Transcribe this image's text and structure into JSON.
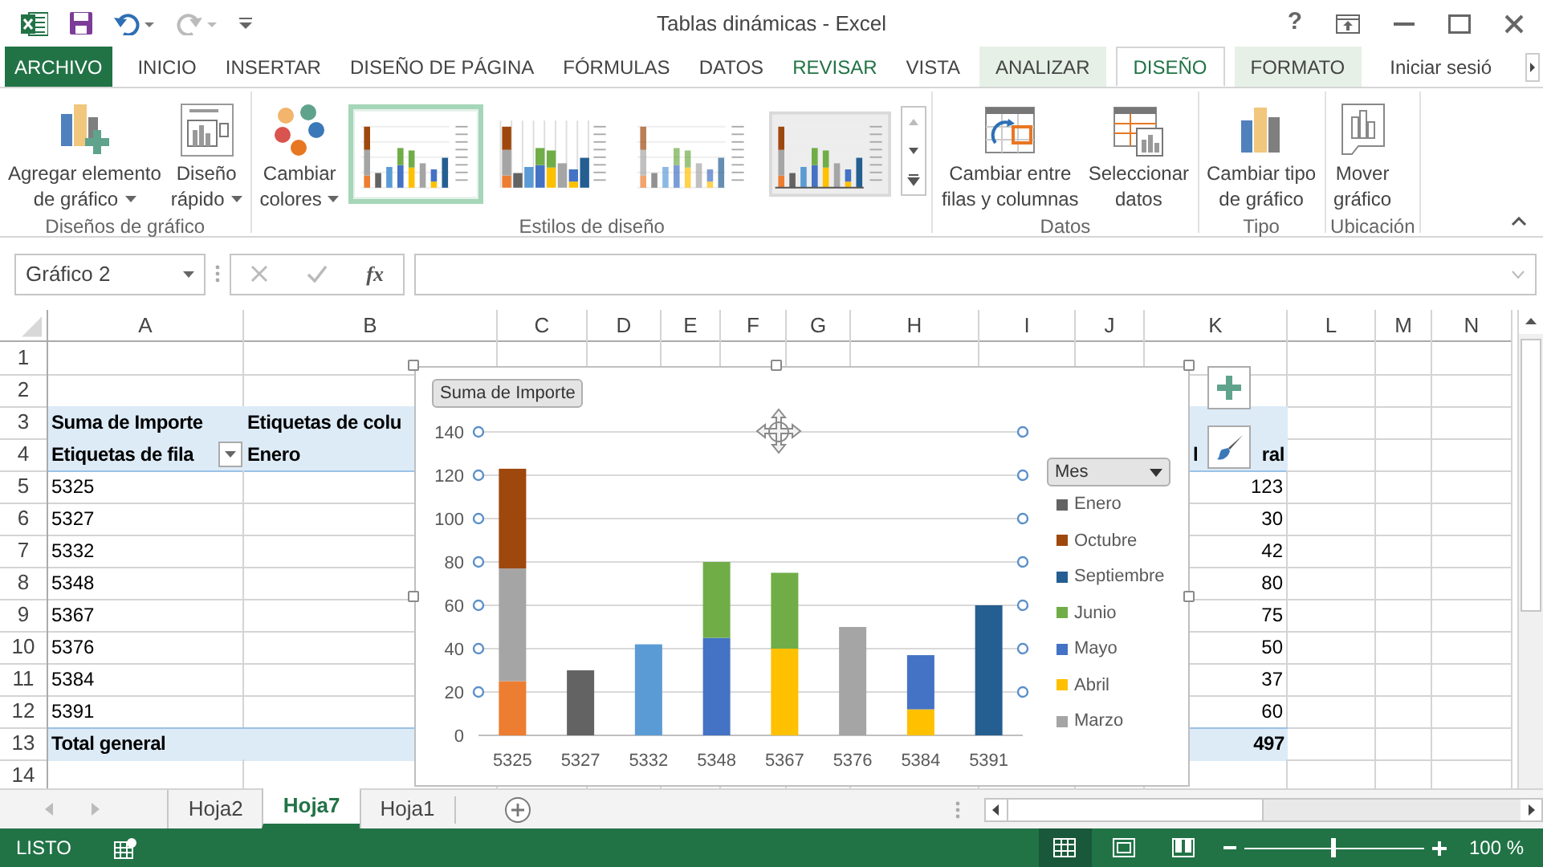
{
  "window": {
    "title": "Tablas dinámicas - Excel",
    "help": "?"
  },
  "ribbon_tabs": [
    {
      "label": "ARCHIVO",
      "kind": "file",
      "selected": false
    },
    {
      "label": "INICIO",
      "kind": "tab",
      "selected": false
    },
    {
      "label": "INSERTAR",
      "kind": "tab",
      "selected": false
    },
    {
      "label": "DISEÑO DE PÁGINA",
      "kind": "tab",
      "selected": false
    },
    {
      "label": "FÓRMULAS",
      "kind": "tab",
      "selected": false
    },
    {
      "label": "DATOS",
      "kind": "tab",
      "selected": false
    },
    {
      "label": "REVISAR",
      "kind": "highlighted",
      "selected": false
    },
    {
      "label": "VISTA",
      "kind": "tab",
      "selected": false
    },
    {
      "label": "ANALIZAR",
      "kind": "contextual",
      "selected": false
    },
    {
      "label": "DISEÑO",
      "kind": "contextual",
      "selected": true
    },
    {
      "label": "FORMATO",
      "kind": "contextual",
      "selected": false
    }
  ],
  "sign_in": "Iniciar sesió",
  "ribbon_groups": [
    {
      "label": "Diseños de gráfico",
      "items": [
        {
          "kind": "button",
          "lines": [
            "Agregar elemento",
            "de gráfico"
          ],
          "dropdown": true
        },
        {
          "kind": "button",
          "lines": [
            "Diseño",
            "rápido"
          ],
          "dropdown": true
        }
      ]
    },
    {
      "label": "Estilos de diseño",
      "items": [
        {
          "kind": "button",
          "lines": [
            "Cambiar",
            "colores"
          ],
          "dropdown": true
        },
        {
          "kind": "gallery",
          "thumbnails": [
            {
              "selected": true
            },
            {
              "selected": false
            },
            {
              "selected": false
            },
            {
              "selected": false
            }
          ]
        }
      ]
    },
    {
      "label": "Datos",
      "items": [
        {
          "kind": "button",
          "lines": [
            "Cambiar entre",
            "filas y columnas"
          ],
          "dropdown": false
        },
        {
          "kind": "button",
          "lines": [
            "Seleccionar",
            "datos"
          ],
          "dropdown": false
        }
      ]
    },
    {
      "label": "Tipo",
      "items": [
        {
          "kind": "button",
          "lines": [
            "Cambiar tipo",
            "de gráfico"
          ],
          "dropdown": false
        }
      ]
    },
    {
      "label": "Ubicación",
      "items": [
        {
          "kind": "button",
          "lines": [
            "Mover",
            "gráfico"
          ],
          "dropdown": false
        }
      ]
    }
  ],
  "formula_bar": {
    "name_box": "Gráfico 2",
    "function_label": "fx"
  },
  "sheet": {
    "columns": [
      "A",
      "B",
      "C",
      "D",
      "E",
      "F",
      "G",
      "H",
      "I",
      "J",
      "K",
      "L",
      "M",
      "N"
    ],
    "rows": [
      {
        "number": "1",
        "kind": "data"
      },
      {
        "number": "2",
        "kind": "data"
      },
      {
        "number": "3",
        "kind": "header",
        "cells": {
          "a": "Suma de Importe",
          "b": "Etiquetas de colu"
        }
      },
      {
        "number": "4",
        "kind": "header",
        "filter": true,
        "cells": {
          "a": "Etiquetas de fila",
          "b": "Enero",
          "k": "l",
          "k_right": "ral"
        }
      },
      {
        "number": "5",
        "kind": "data",
        "cells": {
          "a": "5325",
          "k": "123"
        }
      },
      {
        "number": "6",
        "kind": "data",
        "cells": {
          "a": "5327",
          "k": "30"
        }
      },
      {
        "number": "7",
        "kind": "data",
        "cells": {
          "a": "5332",
          "k": "42"
        }
      },
      {
        "number": "8",
        "kind": "data",
        "cells": {
          "a": "5348",
          "k": "80"
        }
      },
      {
        "number": "9",
        "kind": "data",
        "cells": {
          "a": "5367",
          "k": "75"
        }
      },
      {
        "number": "10",
        "kind": "data",
        "cells": {
          "a": "5376",
          "k": "50"
        }
      },
      {
        "number": "11",
        "kind": "data",
        "cells": {
          "a": "5384",
          "k": "37"
        }
      },
      {
        "number": "12",
        "kind": "data",
        "cells": {
          "a": "5391",
          "k": "60"
        }
      },
      {
        "number": "13",
        "kind": "total",
        "cells": {
          "a": "Total general",
          "k": "497"
        }
      },
      {
        "number": "14",
        "kind": "data"
      }
    ]
  },
  "chart": {
    "field_button": "Suma de Importe",
    "legend_field": "Mes",
    "chart_data": {
      "type": "bar",
      "stacked": true,
      "orientation": "vertical",
      "grid": true,
      "legend": true,
      "categories": [
        "5325",
        "5327",
        "5332",
        "5348",
        "5367",
        "5376",
        "5384",
        "5391"
      ],
      "ylim": [
        0,
        140
      ],
      "yticks": [
        0,
        20,
        40,
        60,
        80,
        100,
        120,
        140
      ],
      "series": [
        {
          "color": "#ed7d31",
          "values": [
            25,
            null,
            null,
            null,
            null,
            null,
            null,
            null
          ]
        },
        {
          "color": "#5b9bd5",
          "values": [
            null,
            null,
            42,
            null,
            null,
            null,
            null,
            null
          ]
        },
        {
          "name": "Marzo",
          "color": "#a5a5a5",
          "values": [
            52,
            null,
            null,
            null,
            null,
            50,
            null,
            null
          ]
        },
        {
          "name": "Abril",
          "color": "#ffc000",
          "values": [
            null,
            null,
            null,
            null,
            40,
            null,
            12,
            null
          ]
        },
        {
          "name": "Mayo",
          "color": "#4472c4",
          "values": [
            null,
            null,
            null,
            45,
            null,
            null,
            25,
            null
          ]
        },
        {
          "name": "Junio",
          "color": "#70ad47",
          "values": [
            null,
            null,
            null,
            35,
            35,
            null,
            null,
            null
          ]
        },
        {
          "name": "Septiembre",
          "color": "#255e91",
          "values": [
            null,
            null,
            null,
            null,
            null,
            null,
            null,
            60
          ]
        },
        {
          "name": "Octubre",
          "color": "#9e480e",
          "values": [
            46,
            null,
            null,
            null,
            null,
            null,
            null,
            null
          ]
        },
        {
          "name": "Enero",
          "color": "#636363",
          "values": [
            null,
            30,
            null,
            null,
            null,
            null,
            null,
            null
          ]
        }
      ]
    }
  },
  "sheet_tabs": [
    {
      "label": "Hoja2",
      "selected": false
    },
    {
      "label": "Hoja7",
      "selected": true
    },
    {
      "label": "Hoja1",
      "selected": false
    }
  ],
  "status_bar": {
    "mode": "LISTO",
    "views": [
      {
        "selected": true
      },
      {
        "selected": false
      },
      {
        "selected": false
      }
    ],
    "zoom_slider": {
      "level": 0.5
    },
    "zoom": "100 %"
  }
}
